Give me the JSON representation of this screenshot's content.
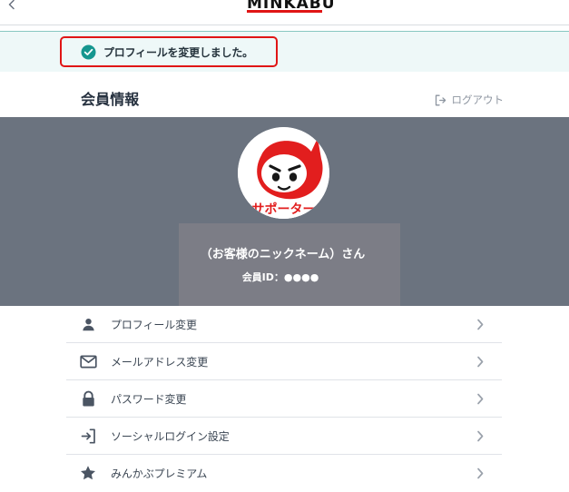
{
  "header": {
    "logo_text": "MINKABU",
    "brand_color": "#e01515",
    "back_icon": "chevron-left-icon"
  },
  "notice": {
    "message": "プロフィールを変更しました。",
    "icon": "check-circle-icon",
    "accent_color": "#15968f",
    "highlight_color": "#e01515"
  },
  "member": {
    "title": "会員情報",
    "logout": {
      "label": "ログアウト",
      "icon": "logout-icon"
    },
    "avatar": {
      "image_text": "サポーター"
    },
    "nickname": "（お客様のニックネーム）さん",
    "id_text": "会員ID：●●●●"
  },
  "menu": {
    "items": [
      {
        "label": "プロフィール変更",
        "icon": "user-icon",
        "chevron_icon": "chevron-right-icon"
      },
      {
        "label": "メールアドレス変更",
        "icon": "mail-icon",
        "chevron_icon": "chevron-right-icon"
      },
      {
        "label": "パスワード変更",
        "icon": "lock-icon",
        "chevron_icon": "chevron-right-icon"
      },
      {
        "label": "ソーシャルログイン設定",
        "icon": "login-arrow-icon",
        "chevron_icon": "chevron-right-icon"
      },
      {
        "label": "みんかぶプレミアム",
        "icon": "star-icon",
        "chevron_icon": "chevron-right-icon"
      }
    ]
  },
  "colors": {
    "banner": "#6b737f",
    "success_background": "#eef8f8"
  }
}
